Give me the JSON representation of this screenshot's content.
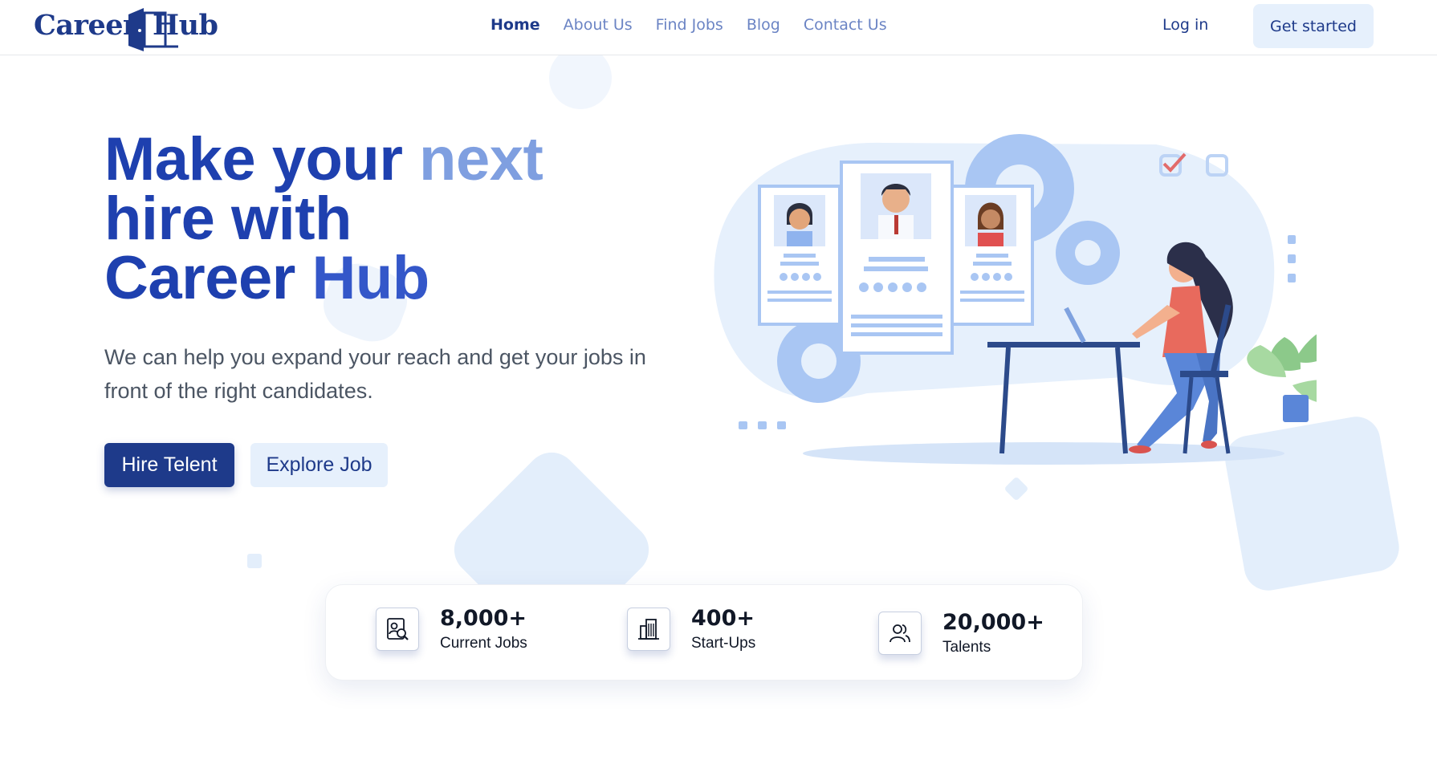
{
  "brand": {
    "word1": "Career",
    "word2": "Hub"
  },
  "nav": {
    "items": [
      {
        "label": "Home",
        "active": true
      },
      {
        "label": "About Us",
        "active": false
      },
      {
        "label": "Find Jobs",
        "active": false
      },
      {
        "label": "Blog",
        "active": false
      },
      {
        "label": "Contact Us",
        "active": false
      }
    ],
    "login": "Log in",
    "cta": "Get started"
  },
  "hero": {
    "title_part1": "Make your ",
    "title_highlight": "next",
    "title_line2": "hire with",
    "title_line3a": "Career ",
    "title_line3b": "Hub",
    "subtitle": "We can help you expand your reach and get your jobs in front of the right candidates.",
    "primary_button": "Hire Telent",
    "secondary_button": "Explore Job"
  },
  "stats": [
    {
      "value": "8,000+",
      "label": "Current Jobs",
      "icon": "job-search-icon"
    },
    {
      "value": "400+",
      "label": "Start-Ups",
      "icon": "building-icon"
    },
    {
      "value": "20,000+",
      "label": "Talents",
      "icon": "users-icon"
    }
  ],
  "colors": {
    "primary": "#1e3a8a",
    "accent_light": "#e6f0fc",
    "nav_inactive": "#6b84c4",
    "heading_highlight": "#7f9fe0"
  }
}
